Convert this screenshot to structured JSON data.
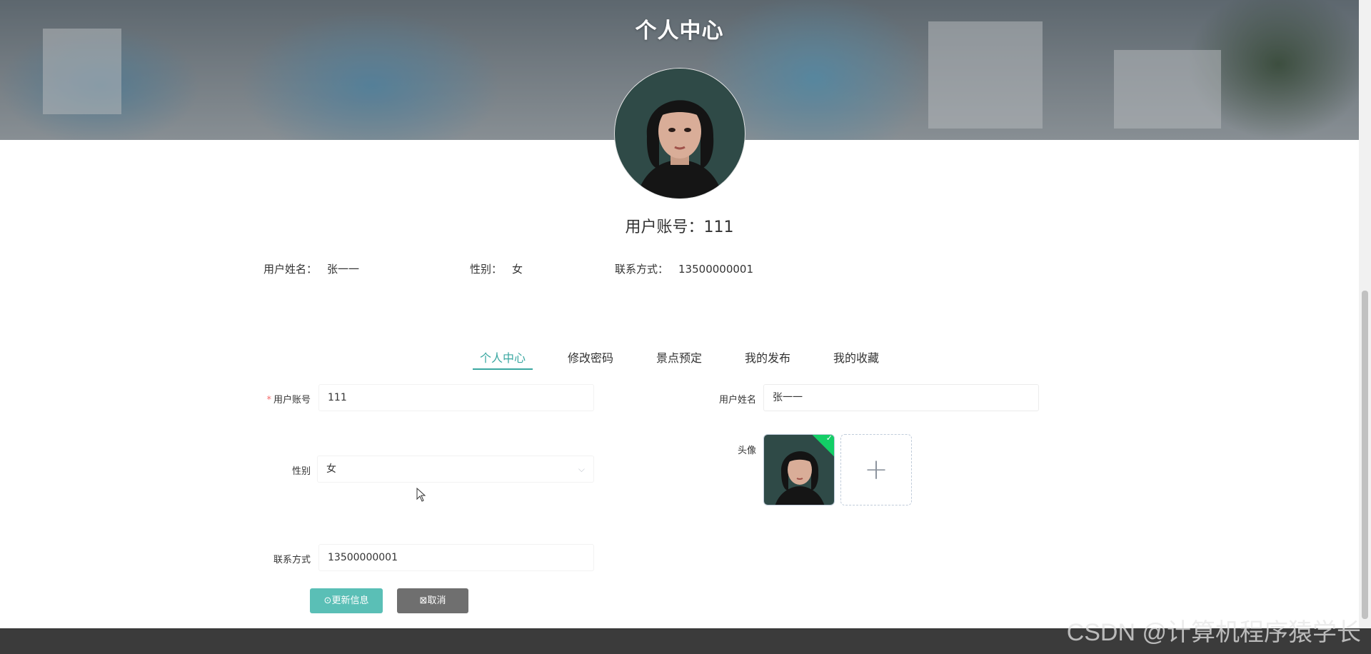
{
  "banner": {
    "title": "个人中心"
  },
  "profile": {
    "account_label": "用户账号：",
    "account_value": "111",
    "name_label": "用户姓名：",
    "name_value": "张一一",
    "gender_label": "性别：",
    "gender_value": "女",
    "phone_label": "联系方式：",
    "phone_value": "13500000001"
  },
  "tabs": [
    {
      "label": "个人中心",
      "active": true
    },
    {
      "label": "修改密码",
      "active": false
    },
    {
      "label": "景点预定",
      "active": false
    },
    {
      "label": "我的发布",
      "active": false
    },
    {
      "label": "我的收藏",
      "active": false
    }
  ],
  "form": {
    "account": {
      "label": "用户账号",
      "required_mark": "*",
      "value": "111"
    },
    "name": {
      "label": "用户姓名",
      "value": "张一一"
    },
    "gender": {
      "label": "性别",
      "value": "女"
    },
    "avatar": {
      "label": "头像"
    },
    "phone": {
      "label": "联系方式",
      "value": "13500000001"
    }
  },
  "buttons": {
    "update": "更新信息",
    "cancel": "取消"
  },
  "watermark": "CSDN @计算机程序猿学长",
  "colors": {
    "accent": "#3aa7a1",
    "update_button": "#5abfb6",
    "cancel_button": "#6f6f6f",
    "success": "#13ce66"
  }
}
